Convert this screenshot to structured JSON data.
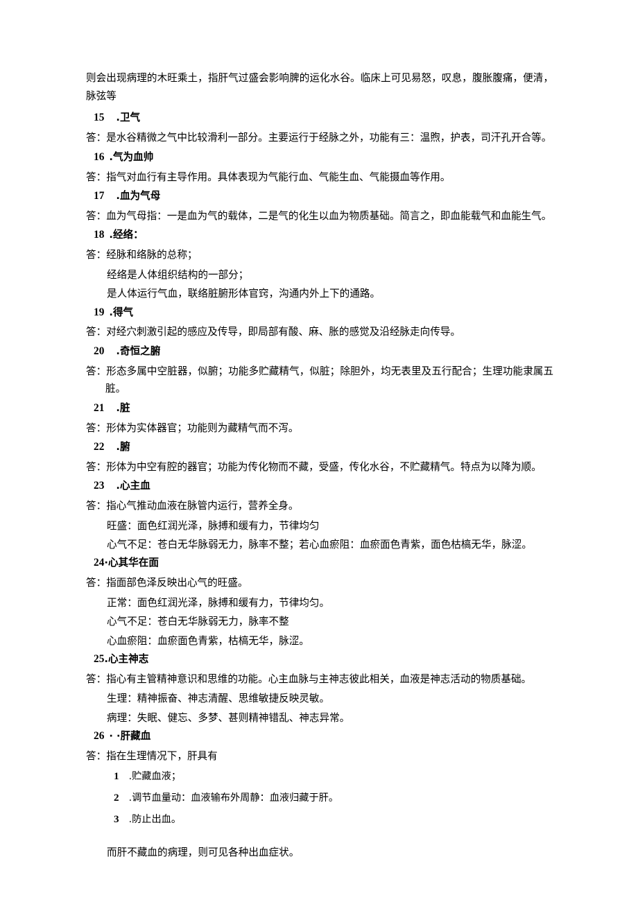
{
  "document": {
    "intro_paragraph": "则会出现病理的木旺乘土，指肝气过盛会影响脾的运化水谷。临床上可见易怒，叹息，腹胀腹痛，便清，脉弦等",
    "entries": [
      {
        "number": "15",
        "separator": ".",
        "term": "卫气",
        "answer": "答：是水谷精微之气中比较滑利一部分。主要运行于经脉之外，功能有三：温煦，护表，司汗孔开合等。",
        "sublines": []
      },
      {
        "number": "16",
        "separator": ".",
        "term": "气为血帅",
        "answer": "答：指气对血行有主导作用。具体表现为气能行血、气能生血、气能摄血等作用。",
        "sublines": []
      },
      {
        "number": "17",
        "separator": ".",
        "term": "血为气母",
        "answer": "答：血为气母指：一是血为气的载体，二是气的化生以血为物质基础。简言之，即血能载气和血能生气。",
        "sublines": []
      },
      {
        "number": "18",
        "separator": ".",
        "term": "经络：",
        "answer": "答：经脉和络脉的总称；",
        "sublines": [
          "经络是人体组织结构的一部分；",
          "是人体运行气血，联络脏腑形体官窍，沟通内外上下的通路。"
        ]
      },
      {
        "number": "19",
        "separator": ".",
        "term": "得气",
        "answer": "答：对经穴刺激引起的感应及传导，即局部有酸、麻、胀的感觉及沿经脉走向传导。",
        "sublines": []
      },
      {
        "number": "20",
        "separator": ".",
        "term": "奇恒之腑",
        "answer": "答：形态多属中空脏器，似腑；功能多贮藏精气，似脏；除胆外，均无表里及五行配合；生理功能隶属五脏。",
        "sublines": []
      },
      {
        "number": "21",
        "separator": ".",
        "term": "脏",
        "answer": "答：形体为实体器官；功能则为藏精气而不泻。",
        "sublines": []
      },
      {
        "number": "22",
        "separator": ".",
        "term": "腑",
        "answer": "答：形体为中空有腔的器官；功能为传化物而不藏，受盛，传化水谷，不贮藏精气。特点为以降为顺。",
        "sublines": []
      },
      {
        "number": "23",
        "separator": ".",
        "term": "心主血",
        "answer": "答：指心气推动血液在脉管内运行，营养全身。",
        "sublines": [
          "旺盛：面色红润光泽，脉搏和缓有力，节律均匀",
          "心气不足：苍白无华脉弱无力，脉率不整；若心血瘀阻：血瘀面色青紫，面色枯槁无华，脉涩。"
        ]
      },
      {
        "number": "24",
        "separator": "·",
        "term": "心其华在面",
        "answer": "答：指面部色泽反映出心气的旺盛。",
        "sublines": [
          "正常：面色红润光泽，脉搏和缓有力，节律均匀。",
          "心气不足：苍白无华脉弱无力，脉率不整",
          "心血瘀阻：血瘀面色青紫，枯槁无华，脉涩。"
        ]
      },
      {
        "number": "25",
        "separator": ".",
        "term": "心主神志",
        "answer": "答：指心有主管精神意识和思维的功能。心主血脉与主神志彼此相关，血液是神志活动的物质基础。",
        "sublines": [
          "生理：精神振奋、神志清醒、思维敏捷反映灵敏。",
          "病理：失眠、健忘、多梦、甚则精神错乱、神志异常。"
        ]
      },
      {
        "number": "26",
        "separator": "· ·",
        "term": "肝藏血",
        "answer": "答：指在生理情况下，肝具有",
        "sublines": []
      }
    ],
    "sub_items": [
      {
        "num": "1",
        "sep": ".",
        "text": "贮藏血液；"
      },
      {
        "num": "2",
        "sep": ".",
        "text": "调节血量动：血液输布外周静：血液归藏于肝。"
      },
      {
        "num": "3",
        "sep": ".",
        "text": "防止出血。"
      }
    ],
    "tail_note": "而肝不藏血的病理，则可见各种出血症状。"
  }
}
